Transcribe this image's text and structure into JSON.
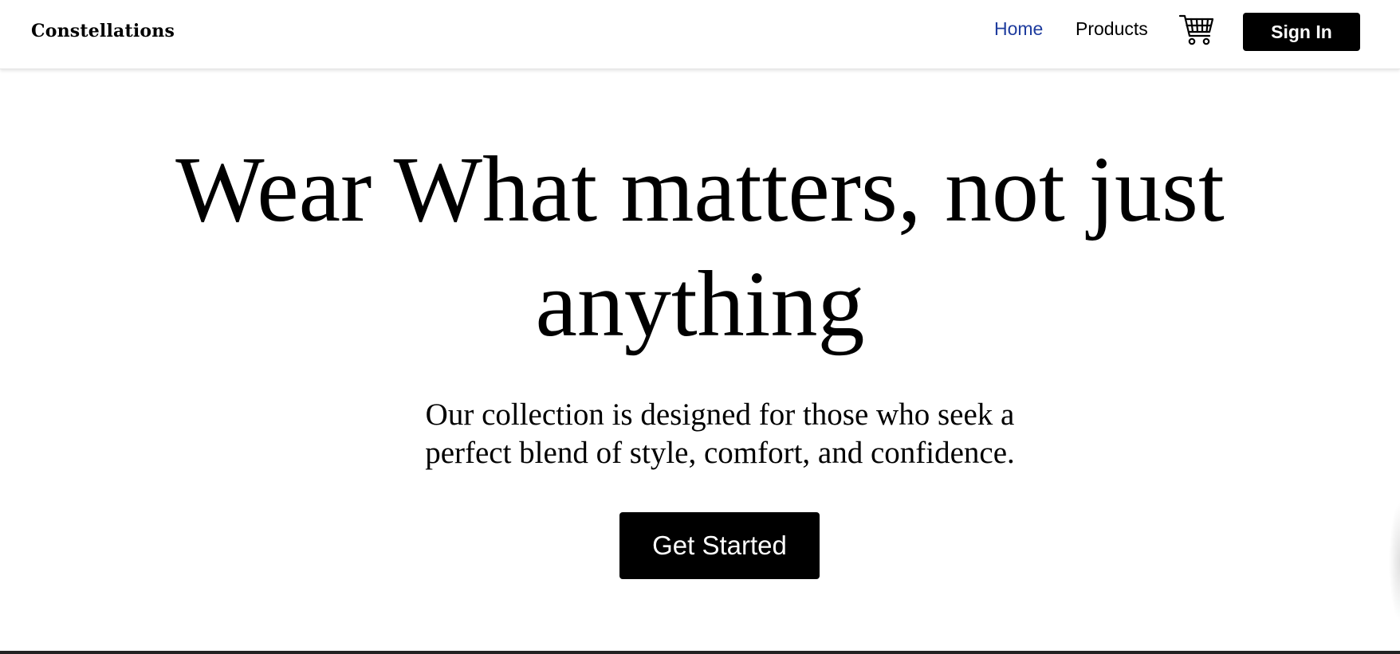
{
  "header": {
    "brand": "Constellations",
    "nav": {
      "home_label": "Home",
      "products_label": "Products"
    },
    "cart_icon": "shopping-cart-icon",
    "signin_label": "Sign In"
  },
  "hero": {
    "title": "Wear What matters, not just anything",
    "subtitle": "Our collection is designed for those who seek a perfect blend of style, comfort, and confidence.",
    "cta_label": "Get Started"
  },
  "colors": {
    "active_link": "#1e3c9e",
    "text": "#000000",
    "button_bg": "#000000",
    "button_text": "#ffffff",
    "background": "#ffffff"
  }
}
